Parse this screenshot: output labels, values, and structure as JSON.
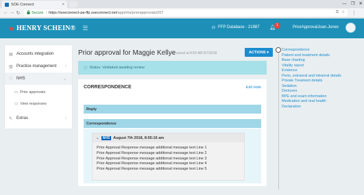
{
  "browser": {
    "tab_title": "SOE Connect",
    "tab_close": "×",
    "window_controls": [
      "—",
      "❐",
      "✕"
    ],
    "nav": {
      "back": "←",
      "forward": "→",
      "reload": "↻"
    },
    "secure_label": "Secure",
    "secure_icon": "lock-icon",
    "url_host": "https://soeconnect-pa-ffp.soeconnect.net",
    "url_path": "/app/nhs/priorapprovals/207",
    "omni_icons": [
      "key-icon",
      "star-icon"
    ]
  },
  "header": {
    "brand": "HENRY SCHEIN®",
    "database_label": "FFP Database - 21987",
    "notification_count": "1",
    "user_name": "PriorApprovalJoan.Jones",
    "accent_color": "#1e90b8"
  },
  "sidebar": {
    "items": [
      {
        "label": "Accounts integration",
        "icon": "stack-icon",
        "chevron": ""
      },
      {
        "label": "Practice management",
        "icon": "building-icon",
        "chevron": "‹"
      },
      {
        "label": "NHS",
        "icon": "heart-icon",
        "chevron": "⌄"
      },
      {
        "label": "Extras",
        "icon": "wrench-icon",
        "chevron": "‹"
      }
    ],
    "subitems": [
      {
        "label": "Prior approvals",
        "icon": "document-icon"
      },
      {
        "label": "View responses",
        "icon": "document-icon"
      }
    ]
  },
  "main": {
    "title": "Prior approval for Maggie Kellye",
    "saved_at": "Last saved at 8:55 AM 8/7/2018",
    "actions_label": "ACTIONS ▾",
    "status": "Status: Validated awaiting review",
    "correspondence": {
      "title": "CORRESPONDENCE",
      "links": "Edit Hide",
      "reply_label": "Reply",
      "panel_label": "Correspondence",
      "message": {
        "toggle": "⌄",
        "badge": "NHS",
        "date": "August 7th 2018, 8:55:16 am",
        "lines": [
          "Prior Approval Response message additional message text Line 1",
          "Prior Approval Response message additional message text Line 2",
          "Prior Approval Response message additional message text Line 3",
          "Prior Approval Response message additional message text Line 4",
          "Prior Approval Response message additional message text Line 5"
        ]
      }
    }
  },
  "right_nav": {
    "items": [
      "Correspondence",
      "Patient and treatment details",
      "Base charting",
      "Vitality report",
      "Evidence",
      "Perio, extraoral and intraoral details",
      "Private Treament details",
      "Sedation",
      "Dentures",
      "BPE and exam information",
      "Medication and oral health",
      "Declaration"
    ]
  }
}
